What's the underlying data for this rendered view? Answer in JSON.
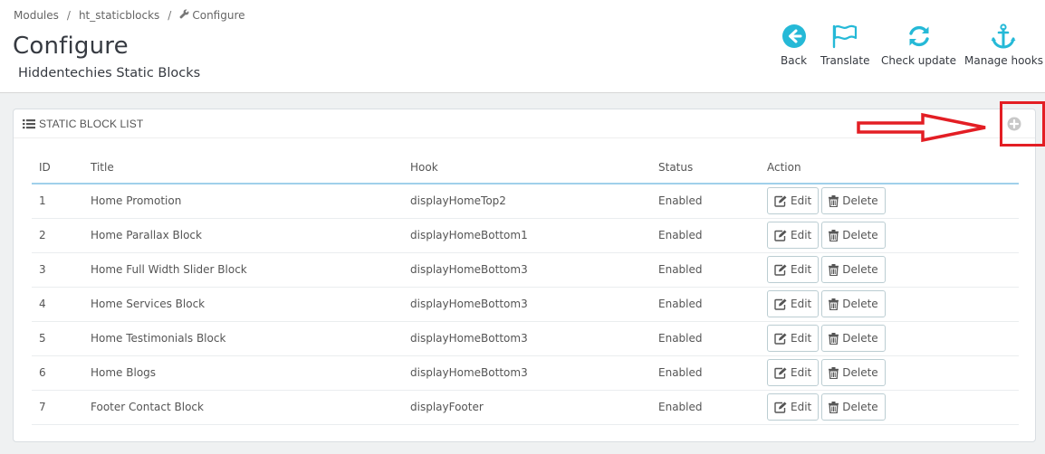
{
  "breadcrumb": {
    "items": [
      "Modules",
      "ht_staticblocks",
      "Configure"
    ]
  },
  "page": {
    "title": "Configure",
    "subtitle": "Hiddentechies Static Blocks"
  },
  "toolbar": {
    "back": "Back",
    "translate": "Translate",
    "check_update": "Check update",
    "manage_hooks": "Manage hooks",
    "accent": "#25b9d7"
  },
  "panel": {
    "title": "Static block list"
  },
  "table": {
    "headers": {
      "id": "ID",
      "title": "Title",
      "hook": "Hook",
      "status": "Status",
      "action": "Action"
    },
    "edit_label": "Edit",
    "delete_label": "Delete",
    "rows": [
      {
        "id": "1",
        "title": "Home Promotion",
        "hook": "displayHomeTop2",
        "status": "Enabled"
      },
      {
        "id": "2",
        "title": "Home Parallax Block",
        "hook": "displayHomeBottom1",
        "status": "Enabled"
      },
      {
        "id": "3",
        "title": "Home Full Width Slider Block",
        "hook": "displayHomeBottom3",
        "status": "Enabled"
      },
      {
        "id": "4",
        "title": "Home Services Block",
        "hook": "displayHomeBottom3",
        "status": "Enabled"
      },
      {
        "id": "5",
        "title": "Home Testimonials Block",
        "hook": "displayHomeBottom3",
        "status": "Enabled"
      },
      {
        "id": "6",
        "title": "Home Blogs",
        "hook": "displayHomeBottom3",
        "status": "Enabled"
      },
      {
        "id": "7",
        "title": "Footer Contact Block",
        "hook": "displayFooter",
        "status": "Enabled"
      }
    ]
  },
  "annotation": {
    "color": "#e31e24"
  }
}
